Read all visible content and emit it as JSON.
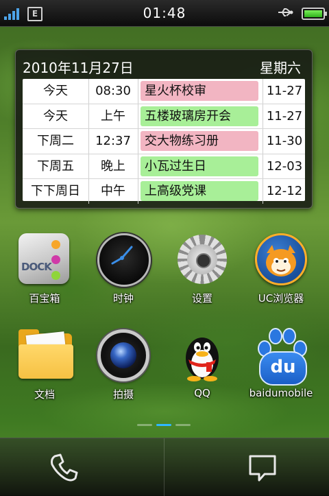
{
  "status_bar": {
    "signal_icon": "signal-bars-icon",
    "network_label": "E",
    "time": "01:48",
    "usb_icon": "usb-icon",
    "battery_icon": "battery-icon",
    "battery_color": "#3fcf2a"
  },
  "calendar_widget": {
    "date": "2010年11月27日",
    "weekday": "星期六",
    "events": [
      {
        "day": "今天",
        "time": "08:30",
        "title": "星火杯校审",
        "date": "11-27",
        "color": "#f2b5c2"
      },
      {
        "day": "今天",
        "time": "上午",
        "title": "五楼玻璃房开会",
        "date": "11-27",
        "color": "#a8ef98"
      },
      {
        "day": "下周二",
        "time": "12:37",
        "title": "交大物练习册",
        "date": "11-30",
        "color": "#f2b5c2"
      },
      {
        "day": "下周五",
        "time": "晚上",
        "title": "小瓦过生日",
        "date": "12-03",
        "color": "#a8ef98"
      },
      {
        "day": "下下周日",
        "time": "中午",
        "title": "上高级党课",
        "date": "12-12",
        "color": "#a8ef98"
      }
    ]
  },
  "apps": [
    {
      "label": "百宝箱",
      "icon": "dock-toolbox-icon"
    },
    {
      "label": "时钟",
      "icon": "clock-icon"
    },
    {
      "label": "设置",
      "icon": "gear-icon"
    },
    {
      "label": "UC浏览器",
      "icon": "uc-browser-icon"
    },
    {
      "label": "文档",
      "icon": "folder-icon"
    },
    {
      "label": "拍摄",
      "icon": "camera-icon"
    },
    {
      "label": "QQ",
      "icon": "qq-penguin-icon"
    },
    {
      "label": "baidumobile",
      "icon": "baidu-paw-icon"
    }
  ],
  "dock_icon_text": "DOCK",
  "baidu_icon_text": "du",
  "page_indicator": {
    "pages": 3,
    "active": 2,
    "active_color": "#2fb8ff"
  },
  "bottom_bar": {
    "left_icon": "phone-icon",
    "right_icon": "message-icon"
  }
}
